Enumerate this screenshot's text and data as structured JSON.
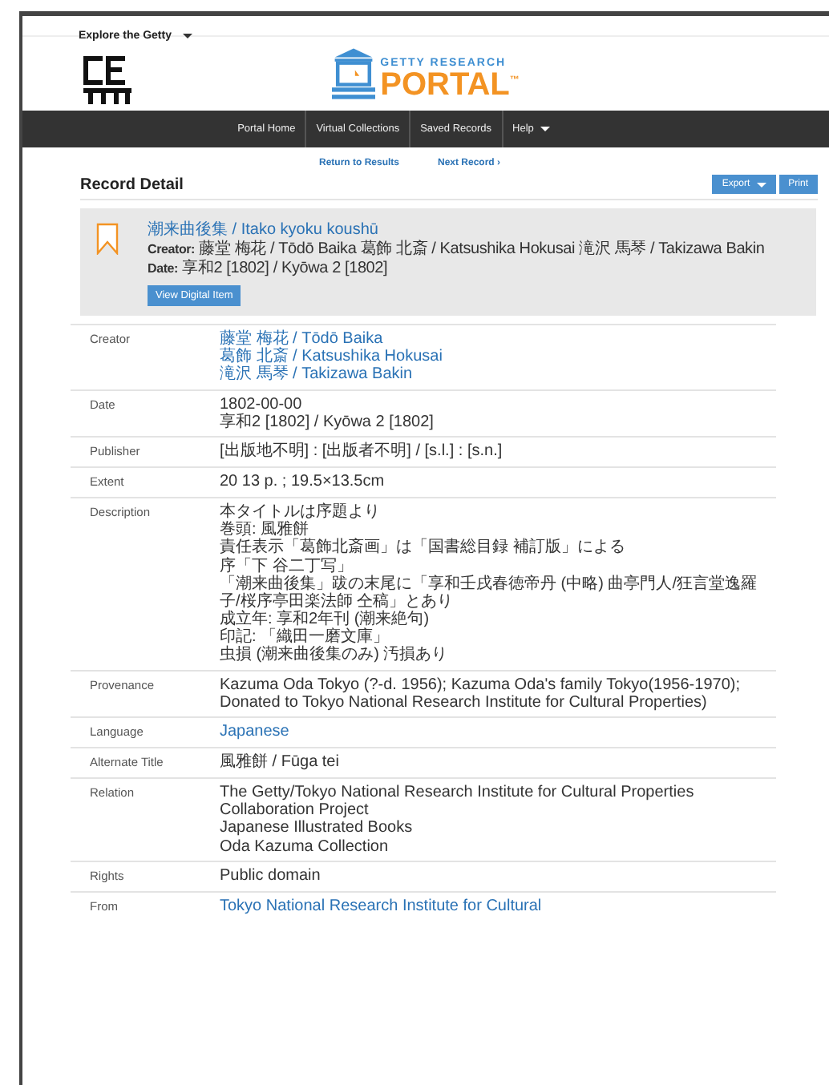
{
  "top_bar": {
    "explore_label": "Explore the Getty"
  },
  "logo": {
    "line1": "GETTY RESEARCH",
    "line2": "PORTAL",
    "mark": "™"
  },
  "nav": {
    "items": [
      {
        "label": "Portal Home",
        "has_menu": false
      },
      {
        "label": "Virtual Collections",
        "has_menu": false
      },
      {
        "label": "Saved Records",
        "has_menu": false
      },
      {
        "label": "Help",
        "has_menu": true
      }
    ]
  },
  "record_nav": {
    "links": [
      "Return to Results",
      "Next Record ›"
    ]
  },
  "heading": "Record Detail",
  "actions": [
    {
      "label": "Export",
      "has_menu": true
    },
    {
      "label": "Print",
      "has_menu": false
    }
  ],
  "summary": {
    "title": "潮来曲後集 / Itako kyoku koushū",
    "fields": [
      {
        "label": "Creator:",
        "value": "藤堂 梅花 / Tōdō Baika  葛飾 北斎 / Katsushika Hokusai  滝沢 馬琴 / Takizawa Bakin"
      },
      {
        "label": "Date:",
        "value": "享和2 [1802] / Kyōwa 2 [1802]"
      }
    ],
    "button": "View Digital Item"
  },
  "fields": [
    {
      "label": "Creator",
      "values": [
        {
          "text": "藤堂 梅花 / Tōdō Baika",
          "link": true
        },
        {
          "text": "葛飾 北斎 / Katsushika Hokusai",
          "link": true
        },
        {
          "text": "滝沢 馬琴 / Takizawa Bakin",
          "link": true
        }
      ]
    },
    {
      "label": "Date",
      "values": [
        {
          "text": "1802-00-00",
          "link": false
        },
        {
          "text": "享和2 [1802] / Kyōwa 2 [1802]",
          "link": false
        }
      ]
    },
    {
      "label": "Publisher",
      "values": [
        {
          "text": "[出版地不明] : [出版者不明] / [s.l.] : [s.n.]",
          "link": false
        }
      ]
    },
    {
      "label": "Extent",
      "values": [
        {
          "text": "20 13 p. ; 19.5×13.5cm",
          "link": false
        }
      ]
    },
    {
      "label": "Description",
      "values": [
        {
          "text": "本タイトルは序題より",
          "link": false
        },
        {
          "text": "巻頭: 風雅餅",
          "link": false
        },
        {
          "text": "責任表示「葛飾北斎画」は「国書総目録 補訂版」による",
          "link": false
        },
        {
          "text": "序「下 谷二丁写」",
          "link": false
        },
        {
          "text": "「潮来曲後集」跋の末尾に「享和壬戌春徳帝丹 (中略) 曲亭門人/狂言堂逸羅子/桜序亭田楽法師 仝稿」とあり",
          "link": false
        },
        {
          "text": "成立年: 享和2年刊 (潮来絶句)",
          "link": false
        },
        {
          "text": "印記: 「織田一磨文庫」",
          "link": false
        },
        {
          "text": "虫損 (潮来曲後集のみ) 汚損あり",
          "link": false
        }
      ]
    },
    {
      "label": "Provenance",
      "values": [
        {
          "text": "Kazuma Oda Tokyo (?-d. 1956); Kazuma Oda's family Tokyo(1956-1970); Donated to Tokyo National Research Institute for Cultural Properties)",
          "link": false
        }
      ]
    },
    {
      "label": "Language",
      "values": [
        {
          "text": "Japanese",
          "link": true
        }
      ]
    },
    {
      "label": "Alternate Title",
      "values": [
        {
          "text": "風雅餅 / Fūga tei",
          "link": false
        }
      ]
    },
    {
      "label": "Relation",
      "values": [
        {
          "text": "The Getty/Tokyo National Research Institute for Cultural Properties Collaboration Project",
          "link": false
        },
        {
          "text": "Japanese Illustrated Books",
          "link": false
        },
        {
          "text": "Oda Kazuma Collection",
          "link": false
        }
      ]
    },
    {
      "label": "Rights",
      "values": [
        {
          "text": "Public domain",
          "link": false
        }
      ]
    },
    {
      "label": "From",
      "values": [
        {
          "text": "Tokyo National Research Institute for Cultural",
          "link": true
        }
      ]
    }
  ]
}
